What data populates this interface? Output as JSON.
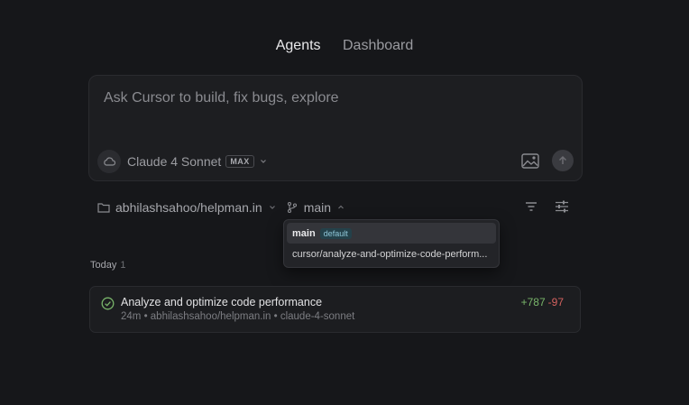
{
  "nav": {
    "tabs": [
      {
        "label": "Agents",
        "active": true
      },
      {
        "label": "Dashboard",
        "active": false
      }
    ]
  },
  "composer": {
    "placeholder": "Ask Cursor to build, fix bugs, explore",
    "model": "Claude 4 Sonnet",
    "model_badge": "MAX",
    "icons": [
      "cloud-icon",
      "chevron-down-icon",
      "image-icon",
      "arrow-up-icon"
    ]
  },
  "repo": {
    "name": "abhilashsahoo/helpman.in",
    "branch": "main",
    "icons": [
      "folder-icon",
      "git-branch-icon",
      "filter-icon",
      "sliders-icon"
    ]
  },
  "branch_dropdown": {
    "items": [
      {
        "name": "main",
        "badge": "default",
        "selected": true
      },
      {
        "name": "cursor/analyze-and-optimize-code-perform...",
        "badge": "",
        "selected": false
      }
    ]
  },
  "group": {
    "label": "Today",
    "count": "1"
  },
  "tasks": [
    {
      "title": "Analyze and optimize code performance",
      "meta": "24m • abhilashsahoo/helpman.in • claude-4-sonnet",
      "additions": "+787",
      "deletions": "-97",
      "status": "completed"
    }
  ],
  "colors": {
    "background": "#16171a",
    "additions": "#79b56a",
    "deletions": "#d4625f",
    "badge": "#8fc6d8"
  }
}
